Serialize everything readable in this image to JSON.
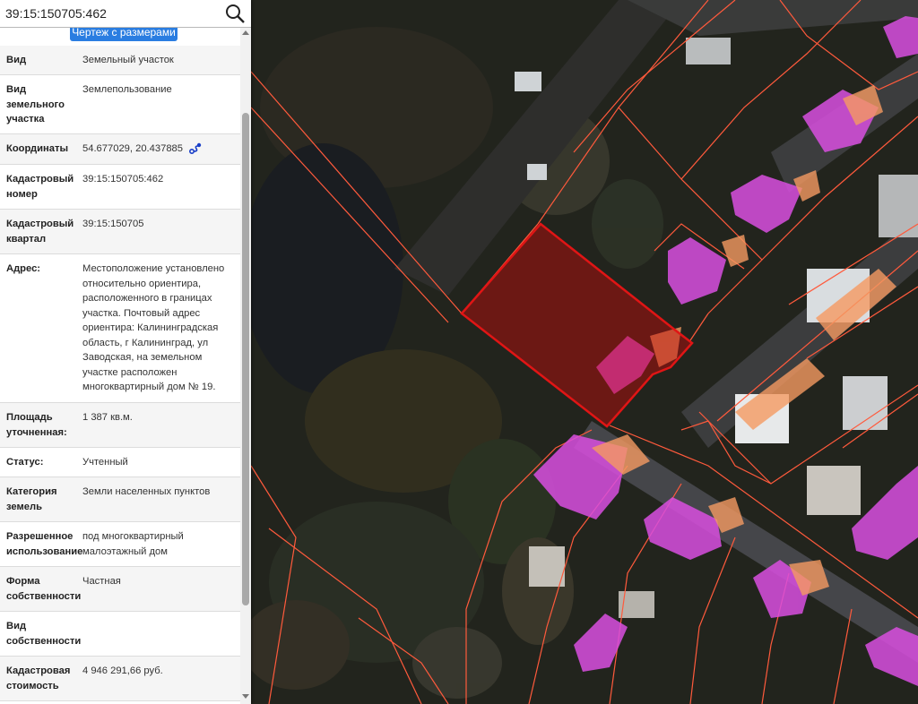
{
  "search": {
    "value": "39:15:150705:462",
    "icon": "search-icon"
  },
  "drawing_button": {
    "label": "Чертеж с размерами"
  },
  "info_rows": [
    {
      "label": "Вид",
      "value": "Земельный участок"
    },
    {
      "label": "Вид земельного участка",
      "value": "Землепользование"
    },
    {
      "label": "Координаты",
      "value": "54.677029, 20.437885",
      "icon": "route-icon"
    },
    {
      "label": "Кадастровый номер",
      "value": "39:15:150705:462"
    },
    {
      "label": "Кадастровый квартал",
      "value": "39:15:150705"
    },
    {
      "label": "Адрес:",
      "value": "Местоположение установлено относительно ориентира, расположенного в границах участка. Почтовый адрес ориентира: Калининградская область, г Калининград, ул Заводская, на земельном участке расположен многоквартирный дом № 19."
    },
    {
      "label": "Площадь уточненная:",
      "value": "1 387 кв.м."
    },
    {
      "label": "Статус:",
      "value": "Учтенный"
    },
    {
      "label": "Категория земель",
      "value": "Земли населенных пунктов"
    },
    {
      "label": "Разрешенное использование",
      "value": "под многоквартирный малоэтажный дом"
    },
    {
      "label": "Форма собственности",
      "value": "Частная"
    },
    {
      "label": "Вид собственности",
      "value": ""
    },
    {
      "label": "Кадастровая стоимость",
      "value": "4 946 291,66 руб."
    }
  ],
  "colors": {
    "selected_parcel": "#e01515",
    "parcel_border": "#ff5a3c",
    "building_magenta": "#d94fe0",
    "building_orange": "#f59a62",
    "accent_button": "#2a7de1",
    "coord_icon": "#1a3fc8"
  }
}
